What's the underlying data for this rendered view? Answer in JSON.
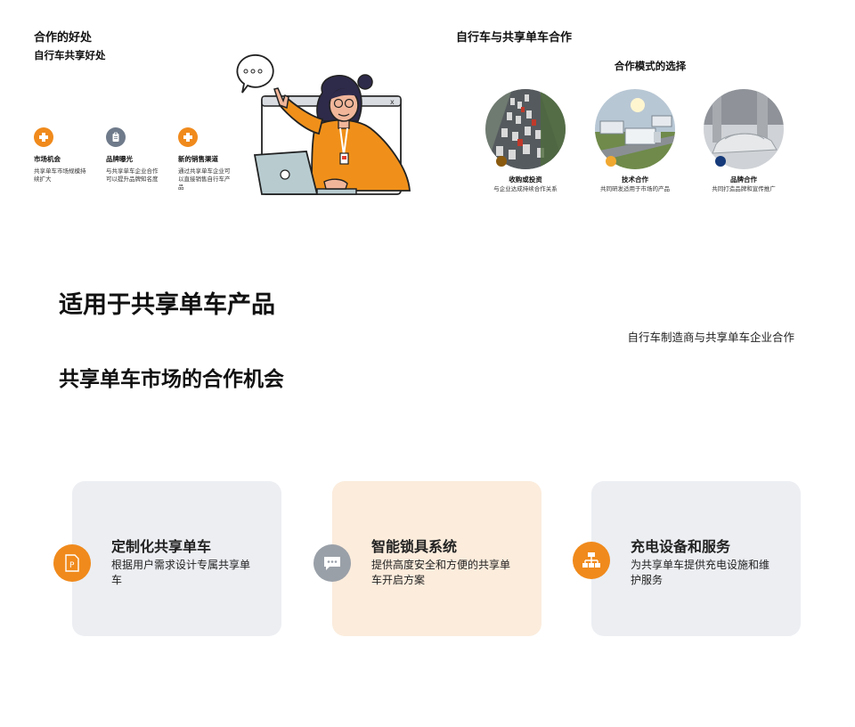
{
  "left_header": {
    "title": "合作的好处",
    "subtitle": "自行车共享好处"
  },
  "benefits": [
    {
      "icon": "puzzle-icon",
      "title": "市场机会",
      "desc": "共享单车市场规模持续扩大"
    },
    {
      "icon": "clipboard-icon",
      "title": "品牌曝光",
      "desc": "与共享单车企业合作可以提升品牌知名度"
    },
    {
      "icon": "puzzle-icon",
      "title": "新的销售渠道",
      "desc": "通过共享单车企业可以直接销售自行车产品"
    }
  ],
  "right_header": {
    "title": "自行车与共享单车合作",
    "subtitle": "合作模式的选择"
  },
  "modes": [
    {
      "image": "traffic-photo",
      "title": "收购或投资",
      "desc": "与企业达成持续合作关系",
      "dot_color": "#8a5a10"
    },
    {
      "image": "trucks-photo",
      "title": "技术合作",
      "desc": "共同研发适用于市场的产品",
      "dot_color": "#f0a830"
    },
    {
      "image": "car-photo",
      "title": "品牌合作",
      "desc": "共同打造品牌和宣传推广",
      "dot_color": "#163a7a"
    }
  ],
  "headline_1": "适用于共享单车产品",
  "headline_2": "共享单车市场的合作机会",
  "side_note": "自行车制造商与共享单车企业合作",
  "cards": [
    {
      "title": "定制化共享单车",
      "desc": "根据用户需求设计专属共享单车",
      "bg": "#eceef2",
      "icon": "document-p-icon",
      "icon_bg": "#f08a1c"
    },
    {
      "title": "智能锁具系统",
      "desc": "提供高度安全和方便的共享单车开启方案",
      "bg": "#fbecdc",
      "icon": "chat-bubble-icon",
      "icon_bg": "#9aa0a8"
    },
    {
      "title": "充电设备和服务",
      "desc": "为共享单车提供充电设施和维护服务",
      "bg": "#eceef2",
      "icon": "network-icon",
      "icon_bg": "#f08a1c"
    }
  ],
  "colors": {
    "accent": "#f08a1c",
    "gray_icon": "#9aa0a8"
  }
}
